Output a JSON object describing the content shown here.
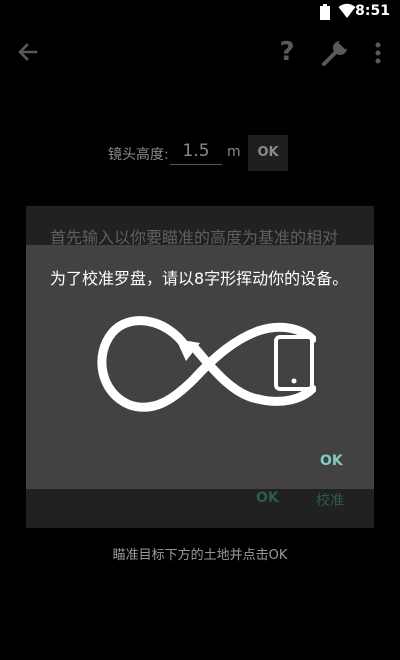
{
  "status_bar": {
    "time": "8:51"
  },
  "toolbar": {
    "help_label": "?"
  },
  "lens_height": {
    "label": "镜头高度:",
    "value": "1.5",
    "unit": "m",
    "ok_label": "OK"
  },
  "background_dialog": {
    "message": "首先输入以你要瞄准的高度为基准的相对",
    "ok_label": "OK",
    "calibrate_label": "校准"
  },
  "calibration_dialog": {
    "message": "为了校准罗盘，请以8字形挥动你的设备。",
    "ok_label": "OK"
  },
  "bottom_hint": "瞄准目标下方的土地并点击OK",
  "colors": {
    "accent": "#80cbc4",
    "dialog_bg": "#424242",
    "screen_bg": "#000000"
  }
}
